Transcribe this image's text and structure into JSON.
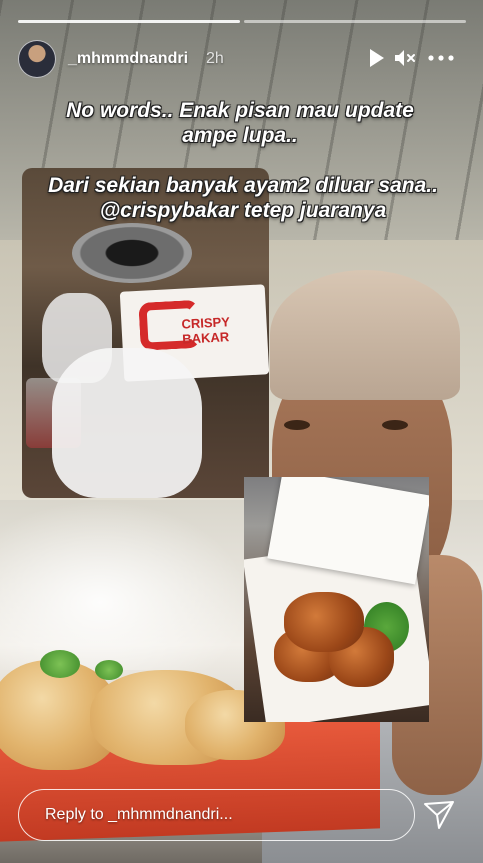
{
  "story": {
    "username": "_mhmmdnandri",
    "time_ago": "2h",
    "progress": [
      1,
      0
    ]
  },
  "header_icons": {
    "play": "play-icon",
    "mute": "speaker-muted-icon",
    "more": "more-options-icon"
  },
  "captions": {
    "line1": "No words.. Enak pisan mau update ampe lupa..",
    "line2": "Dari sekian banyak ayam2 diluar sana.. @crispybakar tetep juaranya"
  },
  "photo1": {
    "box_text": "CRISPY BAKAR"
  },
  "reply": {
    "placeholder": "Reply to _mhmmdnandri...",
    "send_icon": "send-icon"
  },
  "colors": {
    "brand_red": "#d52a2a",
    "box_orange": "#e85a3c"
  }
}
